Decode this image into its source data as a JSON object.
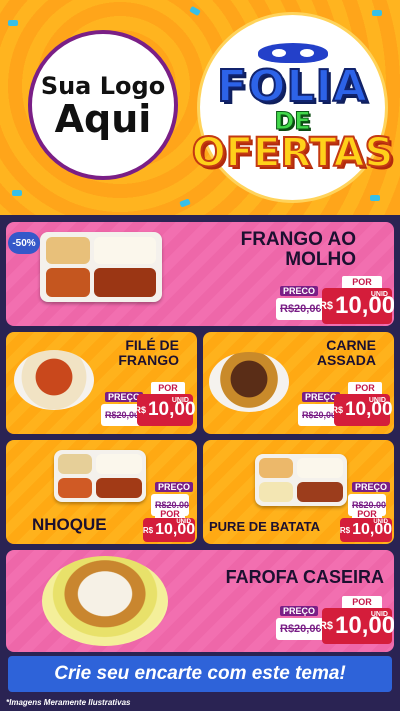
{
  "header": {
    "logo_line1": "Sua Logo",
    "logo_line2": "Aqui",
    "theme_line1": "FOLIA",
    "theme_line2": "DE",
    "theme_line3": "OFERTAS"
  },
  "colors": {
    "pink_card": "#f26fb0",
    "orange_card": "#ffb21c",
    "price_red": "#d41d3b",
    "purple": "#7a1f86",
    "banner_blue": "#2e63d9",
    "background": "#2a2353"
  },
  "discount_badge": "-50%",
  "products": [
    {
      "name_line1": "FRANGO AO",
      "name_line2": "MOLHO",
      "preco_label": "PRECO",
      "old_price": "R$20,00",
      "por_label": "POR",
      "currency": "R$",
      "new_price": "10,00",
      "unit": "UNID"
    },
    {
      "name_line1": "FILÉ DE",
      "name_line2": "FRANGO",
      "preco_label": "PREÇO",
      "old_price": "R$20,00",
      "por_label": "POR",
      "currency": "R$",
      "new_price": "10,00",
      "unit": "UNID"
    },
    {
      "name_line1": "CARNE",
      "name_line2": "ASSADA",
      "preco_label": "PREÇO",
      "old_price": "R$20,00",
      "por_label": "POR",
      "currency": "R$",
      "new_price": "10,00",
      "unit": "UNID"
    },
    {
      "name_line1": "NHOQUE",
      "name_line2": "",
      "preco_label": "PREÇO",
      "old_price": "R$20,00",
      "por_label": "POR",
      "currency": "R$",
      "new_price": "10,00",
      "unit": "UNID"
    },
    {
      "name_line1": "PURE DE BATATA",
      "name_line2": "",
      "preco_label": "PREÇO",
      "old_price": "R$20,00",
      "por_label": "POR",
      "currency": "R$",
      "new_price": "10,00",
      "unit": "UNID"
    },
    {
      "name_line1": "FAROFA CASEIRA",
      "name_line2": "",
      "preco_label": "PREÇO",
      "old_price": "R$20,00",
      "por_label": "POR",
      "currency": "R$",
      "new_price": "10,00",
      "unit": "UNID"
    }
  ],
  "footer": {
    "banner": "Crie seu encarte com este tema!",
    "disclaimer": "*Imagens Meramente Ilustrativas"
  }
}
